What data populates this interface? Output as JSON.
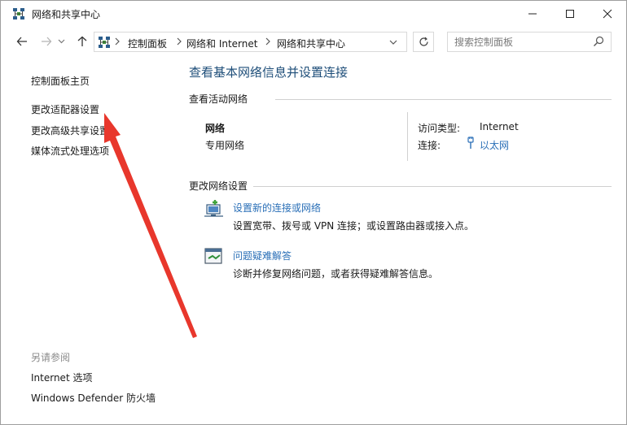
{
  "window": {
    "title": "网络和共享中心"
  },
  "address_bar": {
    "crumbs": [
      "控制面板",
      "网络和 Internet",
      "网络和共享中心"
    ]
  },
  "search": {
    "placeholder": "搜索控制面板"
  },
  "left_pane": {
    "links": [
      "控制面板主页",
      "更改适配器设置",
      "更改高级共享设置",
      "媒体流式处理选项"
    ],
    "see_also_title": "另请参阅",
    "see_also_links": [
      "Internet 选项",
      "Windows Defender 防火墙"
    ]
  },
  "main": {
    "title": "查看基本网络信息并设置连接",
    "active_networks_title": "查看活动网络",
    "network": {
      "name": "网络",
      "type": "专用网络",
      "access_type_label": "访问类型:",
      "access_type_value": "Internet",
      "connections_label": "连接:",
      "connections_value": "以太网"
    },
    "change_settings_title": "更改网络设置",
    "tasks": [
      {
        "link": "设置新的连接或网络",
        "desc": "设置宽带、拨号或 VPN 连接；或设置路由器或接入点。"
      },
      {
        "link": "问题疑难解答",
        "desc": "诊断并修复网络问题，或者获得疑难解答信息。"
      }
    ]
  },
  "colors": {
    "link": "#2a6fb7",
    "title": "#1e4e79",
    "annotation_arrow": "#e8372c"
  }
}
